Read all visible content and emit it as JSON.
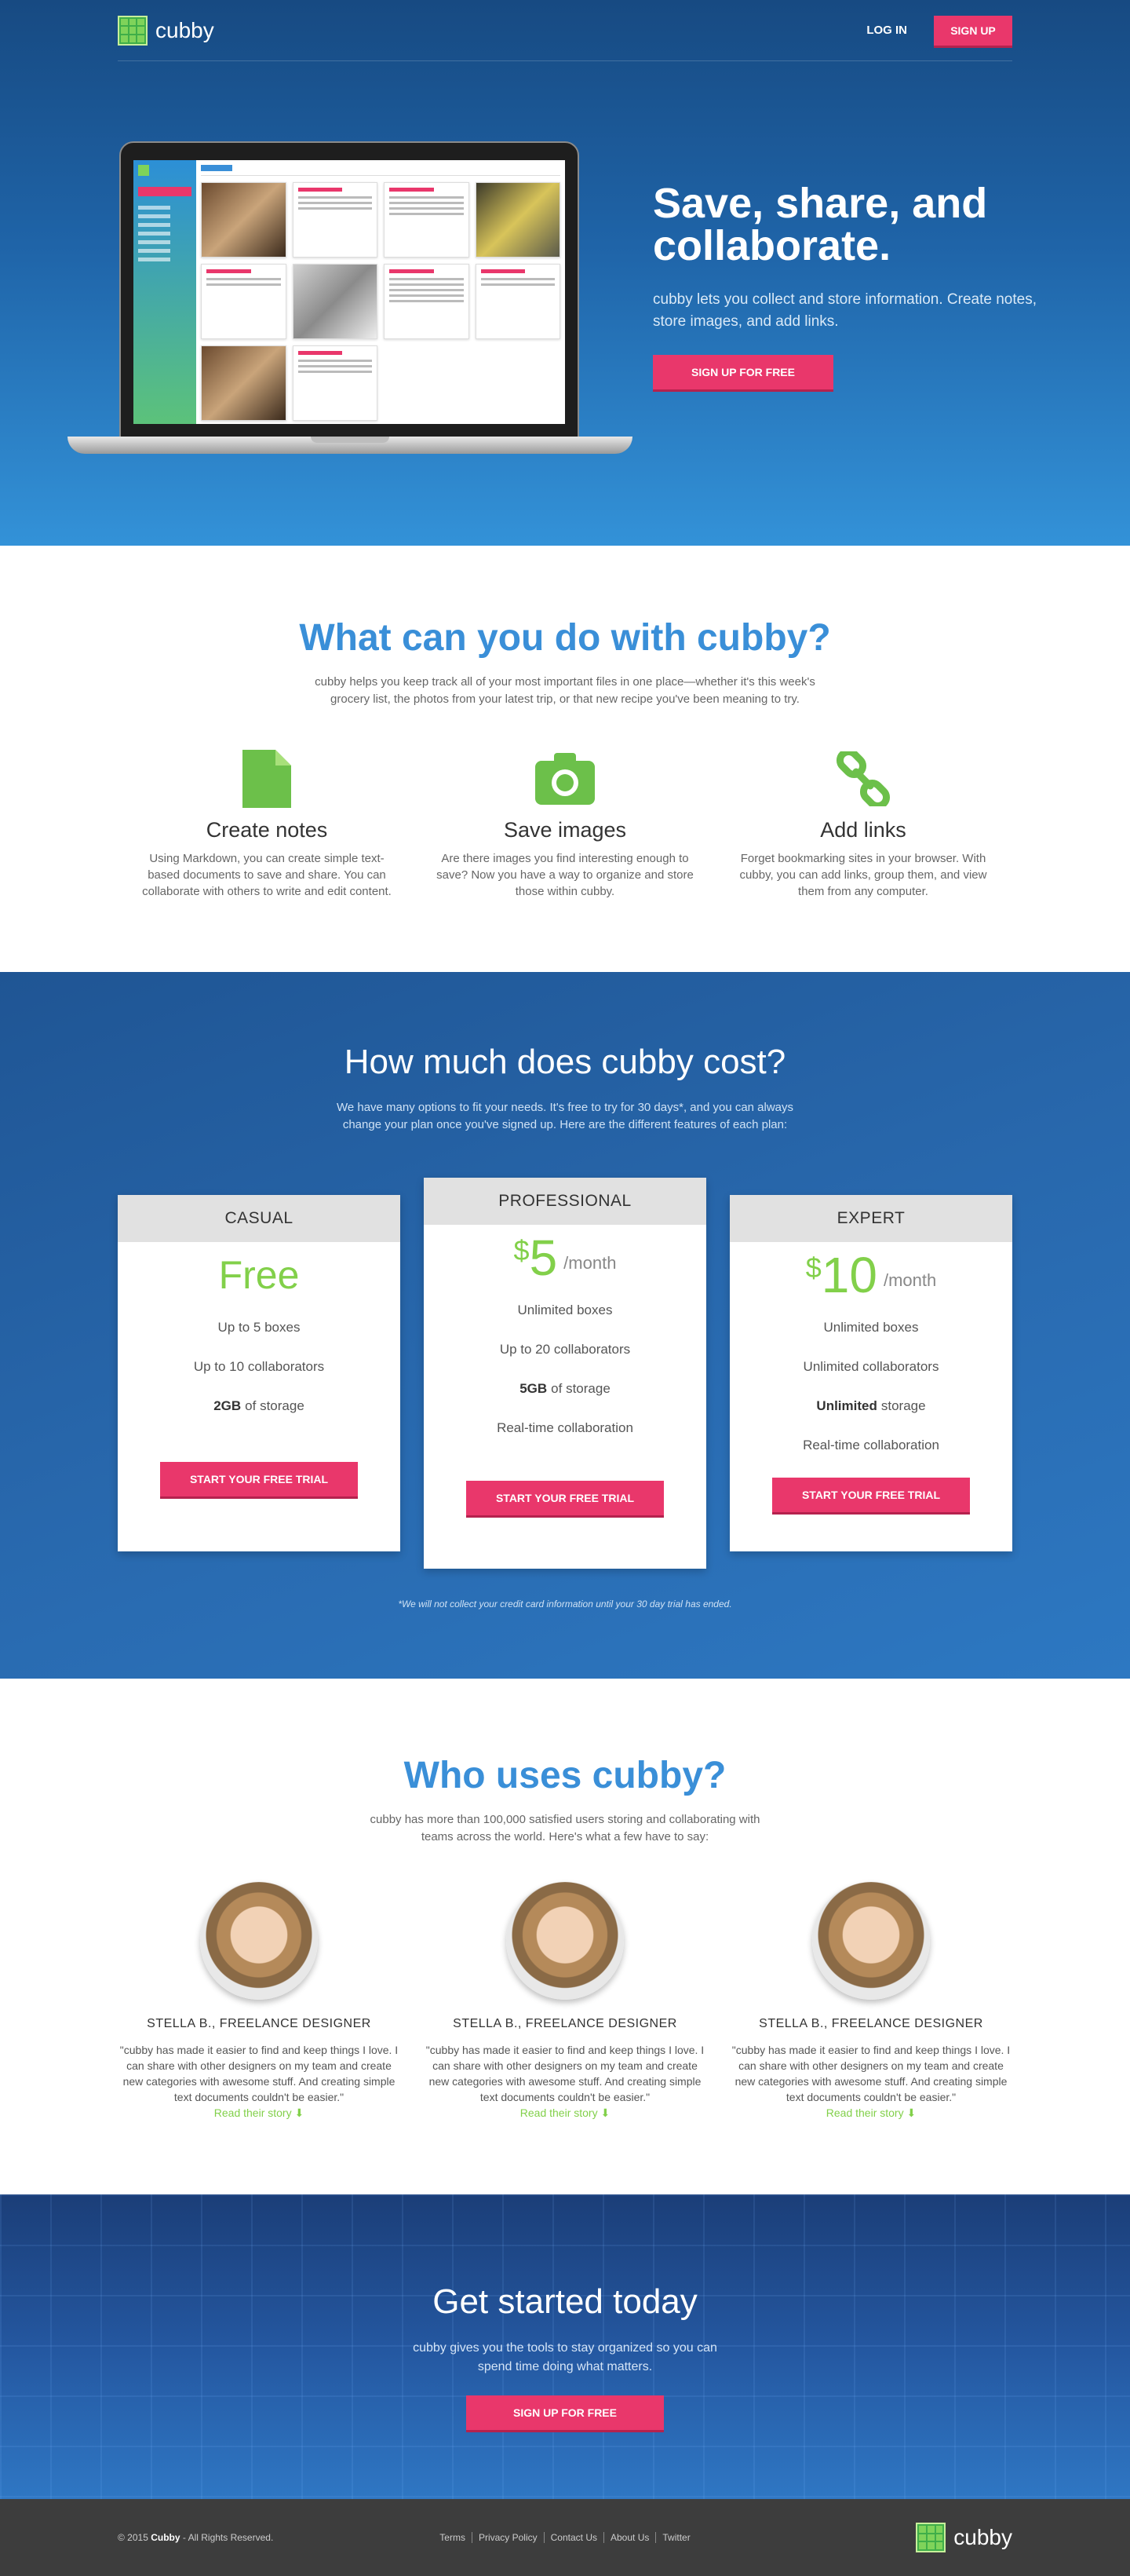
{
  "nav": {
    "brand": "cubby",
    "login": "LOG IN",
    "signup": "SIGN UP"
  },
  "hero": {
    "title": "Save, share, and collaborate.",
    "subtitle": "cubby lets you collect and store information. Create notes, store images, and add links.",
    "cta": "SIGN UP FOR FREE"
  },
  "features": {
    "title": "What can you do with cubby?",
    "subtitle": "cubby helps you keep track all of your most important files in one place—whether it's this week's grocery list, the photos from your latest trip, or that new recipe you've been meaning to try.",
    "items": [
      {
        "icon": "note-icon",
        "title": "Create notes",
        "text": "Using Markdown, you can create simple text-based documents to save and share. You can collaborate with others to write and edit content."
      },
      {
        "icon": "camera-icon",
        "title": "Save images",
        "text": "Are there images you find interesting enough to save? Now you have a way to organize and store those within cubby."
      },
      {
        "icon": "link-icon",
        "title": "Add links",
        "text": "Forget bookmarking sites in your browser. With cubby, you can add links, group them, and view them from any computer."
      }
    ]
  },
  "pricing": {
    "title": "How much does cubby cost?",
    "subtitle": "We have many options to fit your needs. It's free to try for 30 days*, and you can always change your plan once you've signed up. Here are the different features of each plan:",
    "plans": [
      {
        "name": "CASUAL",
        "price": "Free",
        "f1": "Up to 5 boxes",
        "f2": "Up to 10 collaborators",
        "f3b": "2GB",
        "f3": "of storage",
        "cta": "START YOUR FREE TRIAL"
      },
      {
        "name": "PROFESSIONAL",
        "currency": "$",
        "price": "5",
        "period": "/month",
        "f1": "Unlimited boxes",
        "f2": "Up to 20 collaborators",
        "f3b": "5GB",
        "f3": "of storage",
        "f4": "Real-time collaboration",
        "cta": "START YOUR FREE TRIAL"
      },
      {
        "name": "EXPERT",
        "currency": "$",
        "price": "10",
        "period": "/month",
        "f1": "Unlimited boxes",
        "f2": "Unlimited collaborators",
        "f3b": "Unlimited",
        "f3": "storage",
        "f4": "Real-time collaboration",
        "cta": "START YOUR FREE TRIAL"
      }
    ],
    "disclaimer": "*We will not collect your credit card information until your 30 day trial has ended."
  },
  "testimonials": {
    "title": "Who uses cubby?",
    "subtitle": "cubby has more than 100,000 satisfied users storing and collaborating with teams across the world. Here's what a few have to say:",
    "items": [
      {
        "name": "STELLA B., FREELANCE DESIGNER",
        "quote": "\"cubby has made it easier to find and keep things I love. I can share with other designers on my team and create new categories with awesome stuff. And creating simple text documents couldn't be easier.\"",
        "link": "Read their story ⬇"
      },
      {
        "name": "STELLA B., FREELANCE DESIGNER",
        "quote": "\"cubby has made it easier to find and keep things I love. I can share with other designers on my team and create new categories with awesome stuff. And creating simple text documents couldn't be easier.\"",
        "link": "Read their story ⬇"
      },
      {
        "name": "STELLA B., FREELANCE DESIGNER",
        "quote": "\"cubby has made it easier to find and keep things I love. I can share with other designers on my team and create new categories with awesome stuff. And creating simple text documents couldn't be easier.\"",
        "link": "Read their story ⬇"
      }
    ]
  },
  "cta": {
    "title": "Get started today",
    "text": "cubby gives you the tools to stay organized so you can spend time doing what matters.",
    "button": "SIGN UP FOR FREE"
  },
  "footer": {
    "copy_pre": "© 2015",
    "copy_brand": "Cubby",
    "copy_post": "- All Rights Reserved.",
    "links": [
      "Terms",
      "Privacy Policy",
      "Contact Us",
      "About Us",
      "Twitter"
    ],
    "brand": "cubby"
  },
  "colors": {
    "accent": "#e9376b",
    "blue": "#3a8fd8",
    "green": "#82d04a"
  }
}
